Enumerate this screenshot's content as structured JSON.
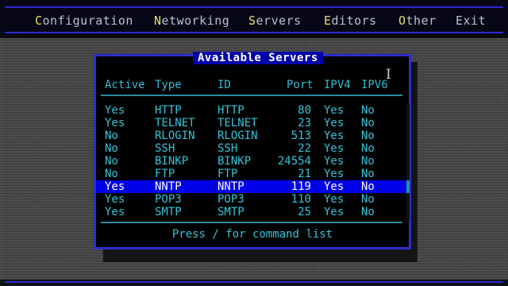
{
  "menu": [
    {
      "hot": "C",
      "rest": "onfiguration"
    },
    {
      "hot": "N",
      "rest": "etworking"
    },
    {
      "hot": "S",
      "rest": "ervers"
    },
    {
      "hot": "E",
      "rest": "ditors"
    },
    {
      "hot": "O",
      "rest": "ther"
    },
    {
      "hot": "",
      "rest": "Exit"
    }
  ],
  "dialog": {
    "title": "Available Servers",
    "columns": {
      "active": "Active",
      "type": "Type",
      "id": "ID",
      "port": "Port",
      "ipv4": "IPV4",
      "ipv6": "IPV6"
    },
    "rows": [
      {
        "active": "Yes",
        "type": "HTTP",
        "id": "HTTP",
        "port": "80",
        "ipv4": "Yes",
        "ipv6": "No"
      },
      {
        "active": "Yes",
        "type": "TELNET",
        "id": "TELNET",
        "port": "23",
        "ipv4": "Yes",
        "ipv6": "No"
      },
      {
        "active": "No",
        "type": "RLOGIN",
        "id": "RLOGIN",
        "port": "513",
        "ipv4": "Yes",
        "ipv6": "No"
      },
      {
        "active": "No",
        "type": "SSH",
        "id": "SSH",
        "port": "22",
        "ipv4": "Yes",
        "ipv6": "No"
      },
      {
        "active": "No",
        "type": "BINKP",
        "id": "BINKP",
        "port": "24554",
        "ipv4": "Yes",
        "ipv6": "No"
      },
      {
        "active": "No",
        "type": "FTP",
        "id": "FTP",
        "port": "21",
        "ipv4": "Yes",
        "ipv6": "No"
      },
      {
        "active": "Yes",
        "type": "NNTP",
        "id": "NNTP",
        "port": "119",
        "ipv4": "Yes",
        "ipv6": "No"
      },
      {
        "active": "Yes",
        "type": "POP3",
        "id": "POP3",
        "port": "110",
        "ipv4": "Yes",
        "ipv6": "No"
      },
      {
        "active": "Yes",
        "type": "SMTP",
        "id": "SMTP",
        "port": "25",
        "ipv4": "Yes",
        "ipv6": "No"
      }
    ],
    "selected_row": 6,
    "footer": "Press / for command list"
  },
  "colors": {
    "menu_hotkey": "#e8e16a",
    "menu_text": "#b9c2cc",
    "dialog_border": "#2d2dcc",
    "title_bg": "#0000aa",
    "cell_text": "#35c4d8",
    "selection_bg": "#0000e8"
  },
  "icons": {
    "mouse_cursor": "text-cursor-icon"
  }
}
